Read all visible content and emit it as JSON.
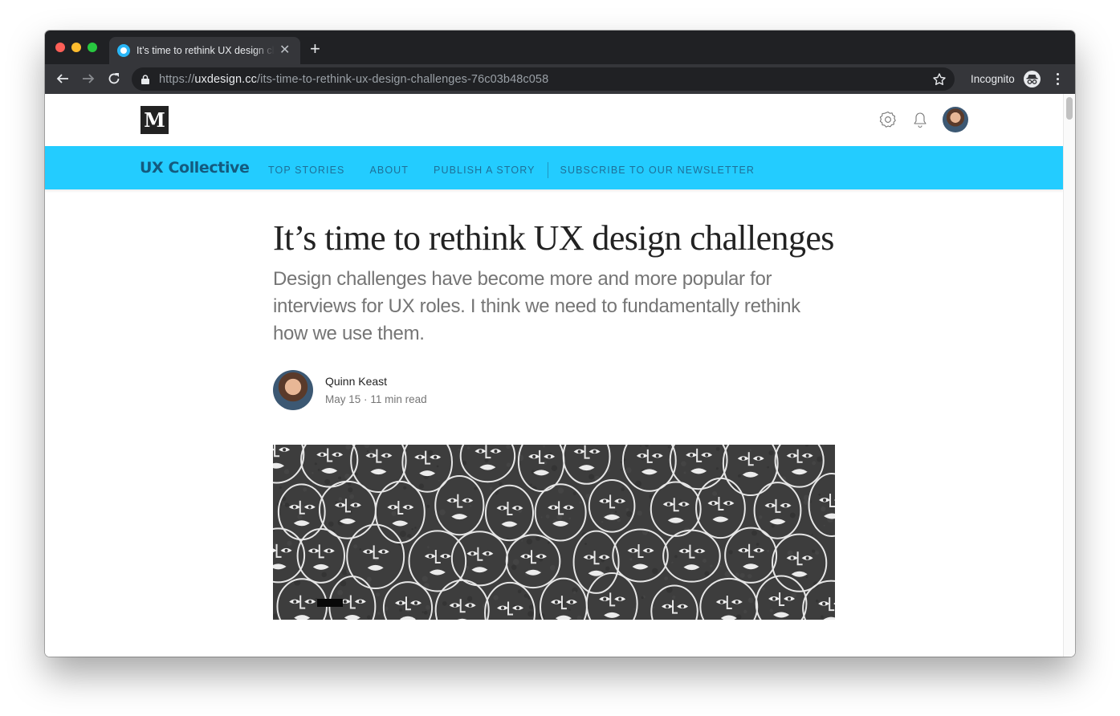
{
  "browser": {
    "tab": {
      "title": "It’s time to rethink UX design challenges",
      "favicon": "uxdesign-favicon"
    },
    "url": {
      "scheme": "https://",
      "host": "uxdesign.cc",
      "path": "/its-time-to-rethink-ux-design-challenges-76c03b48c058"
    },
    "incognito_label": "Incognito",
    "icons": {
      "back": "arrow-left-icon",
      "forward": "arrow-right-icon",
      "reload": "reload-icon",
      "lock": "lock-icon",
      "bookmark": "star-icon",
      "incognito": "incognito-icon",
      "menu": "more-vert-icon",
      "new_tab": "plus-icon",
      "close_tab": "close-icon"
    }
  },
  "medium_header": {
    "logo": "M",
    "icons": [
      "gear-icon",
      "bell-icon",
      "avatar"
    ]
  },
  "publication": {
    "name": "UX Collective",
    "color": "#23ccff",
    "links": [
      "Top stories",
      "About",
      "Publish a story",
      "Subscribe to our newsletter"
    ]
  },
  "article": {
    "title": "It’s time to rethink UX design challenges",
    "subtitle": "Design challenges have become more and more popular for interviews for UX roles. I think we need to fundamentally rethink how we use them.",
    "author": "Quinn Keast",
    "date": "May 15",
    "separator": "·",
    "read_time": "11 min read",
    "hero_image_alt": "Wall mural of white line-drawn faces on dark gray background"
  }
}
